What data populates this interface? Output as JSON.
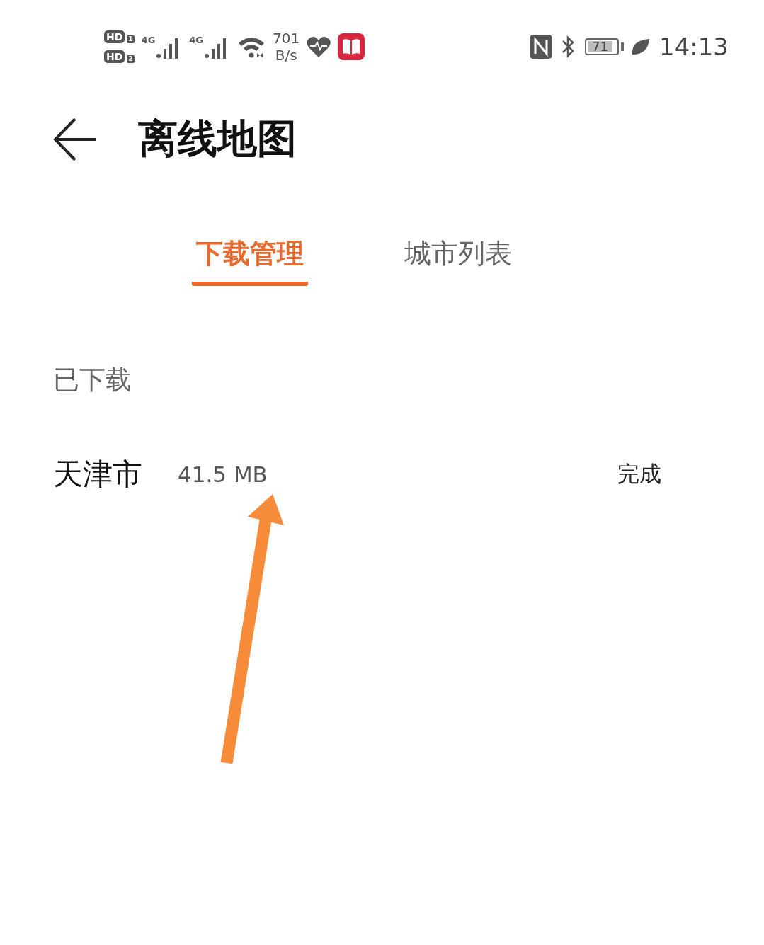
{
  "status_bar": {
    "sim_badges": [
      {
        "label": "HD",
        "slot": "1"
      },
      {
        "label": "HD",
        "slot": "2"
      }
    ],
    "networks": [
      "4G",
      "4G"
    ],
    "speed_value": "701",
    "speed_unit": "B/s",
    "battery": "71",
    "time": "14:13"
  },
  "header": {
    "title": "离线地图"
  },
  "tabs": [
    {
      "label": "下载管理",
      "selected": true
    },
    {
      "label": "城市列表",
      "selected": false
    }
  ],
  "section": {
    "title": "已下载"
  },
  "downloads": [
    {
      "city": "天津市",
      "size": "41.5 MB",
      "status": "完成"
    }
  ]
}
